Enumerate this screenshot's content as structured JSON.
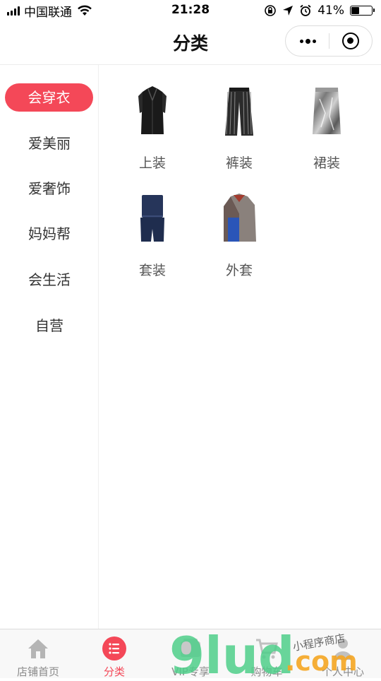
{
  "status_bar": {
    "carrier": "中国联通",
    "time": "21:28",
    "battery_text": "41%",
    "battery_level": 0.41,
    "icons": [
      "signal-icon",
      "wifi-icon",
      "orientation-lock-icon",
      "location-icon",
      "alarm-icon",
      "battery-icon"
    ]
  },
  "nav": {
    "title": "分类",
    "capsule_icons": [
      "more-dots-icon",
      "close-target-icon"
    ]
  },
  "sidebar": {
    "items": [
      {
        "label": "会穿衣",
        "active": true
      },
      {
        "label": "爱美丽",
        "active": false
      },
      {
        "label": "爱奢饰",
        "active": false
      },
      {
        "label": "妈妈帮",
        "active": false
      },
      {
        "label": "会生活",
        "active": false
      },
      {
        "label": "自营",
        "active": false
      }
    ]
  },
  "categories": [
    {
      "label": "上装",
      "icon": "vest-icon"
    },
    {
      "label": "裤装",
      "icon": "pants-icon"
    },
    {
      "label": "裙装",
      "icon": "skirt-icon"
    },
    {
      "label": "套装",
      "icon": "suit-icon"
    },
    {
      "label": "外套",
      "icon": "coat-icon"
    }
  ],
  "tabbar": {
    "tabs": [
      {
        "label": "店铺首页",
        "icon": "home-icon",
        "active": false
      },
      {
        "label": "分类",
        "icon": "list-icon",
        "active": true
      },
      {
        "label": "VIP专享",
        "icon": "vip-icon",
        "active": false
      },
      {
        "label": "购物车",
        "icon": "cart-icon",
        "active": false
      },
      {
        "label": "个人中心",
        "icon": "person-icon",
        "active": false
      }
    ]
  },
  "watermark": {
    "brand": "9lud",
    "domain": ".com",
    "tagline": "小程序商店"
  },
  "colors": {
    "accent": "#f44858",
    "watermark_green": "#4fcf8a",
    "watermark_orange": "#f5a623"
  }
}
